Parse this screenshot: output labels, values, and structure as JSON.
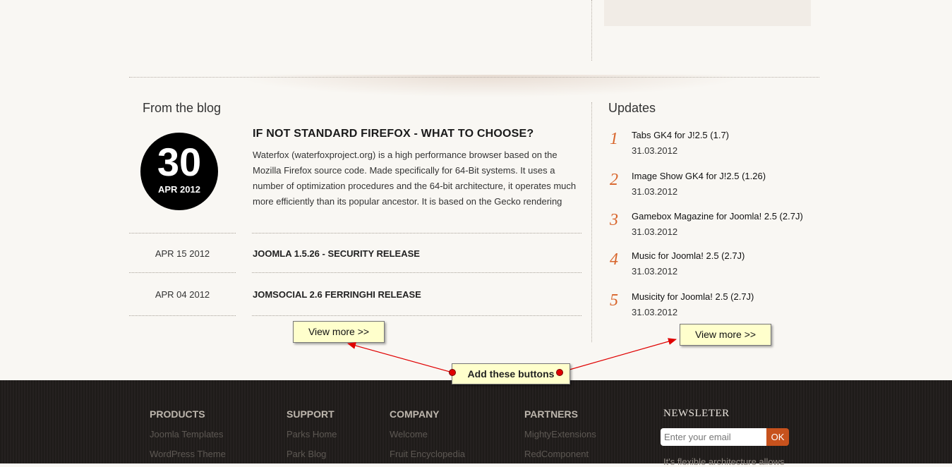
{
  "blog": {
    "section_title": "From the blog",
    "featured": {
      "day": "30",
      "month_year": "APR 2012",
      "title": "IF NOT STANDARD FIREFOX - WHAT TO CHOOSE?",
      "excerpt": "Waterfox (waterfoxproject.org) is a high performance browser based on the Mozilla Firefox source code. Made specifically for 64-Bit systems. It uses a number of optimization procedures and the 64-bit architecture, it operates much more efficiently than its popular ancestor. It is based on the Gecko rendering"
    },
    "posts": [
      {
        "date": "APR 15 2012",
        "title": "JOOMLA 1.5.26 - SECURITY RELEASE"
      },
      {
        "date": "APR 04 2012",
        "title": "JOMSOCIAL 2.6 FERRINGHI RELEASE"
      }
    ],
    "view_more": "View more >>"
  },
  "updates": {
    "section_title": "Updates",
    "items": [
      {
        "num": "1",
        "title": "Tabs GK4 for J!2.5 (1.7)",
        "date": "31.03.2012"
      },
      {
        "num": "2",
        "title": "Image Show GK4 for J!2.5 (1.26)",
        "date": "31.03.2012"
      },
      {
        "num": "3",
        "title": "Gamebox Magazine for Joomla! 2.5 (2.7J)",
        "date": "31.03.2012"
      },
      {
        "num": "4",
        "title": "Music for Joomla! 2.5 (2.7J)",
        "date": "31.03.2012"
      },
      {
        "num": "5",
        "title": "Musicity for Joomla! 2.5 (2.7J)",
        "date": "31.03.2012"
      }
    ],
    "view_more": "View more >>"
  },
  "annotation": {
    "label": "Add these buttons",
    "arrow_color": "#e00000"
  },
  "footer": {
    "columns": [
      {
        "heading": "PRODUCTS",
        "links": [
          "Joomla Templates",
          "WordPress Theme"
        ]
      },
      {
        "heading": "SUPPORT",
        "links": [
          "Parks Home",
          "Park Blog"
        ]
      },
      {
        "heading": "COMPANY",
        "links": [
          "Welcome",
          "Fruit Encyclopedia"
        ]
      },
      {
        "heading": "PARTNERS",
        "links": [
          "MightyExtensions",
          "RedComponent"
        ]
      }
    ],
    "newsletter": {
      "heading": "NEWSLETER",
      "placeholder": "Enter your email",
      "button": "OK",
      "text": "It's flexible architecture allows"
    }
  },
  "colors": {
    "accent": "#d8642a",
    "footer_bg": "#1e1b19",
    "button_bg": "#ffffcc",
    "ok_button": "#c7521d"
  }
}
